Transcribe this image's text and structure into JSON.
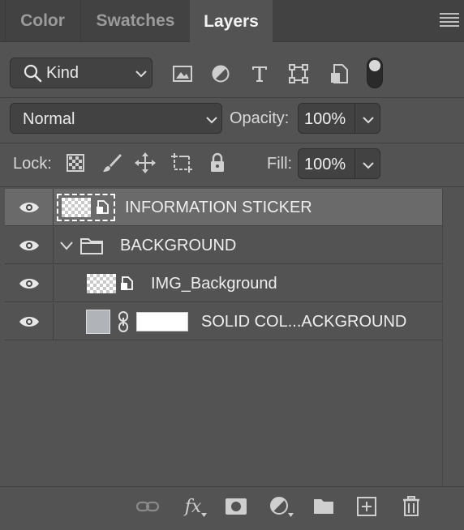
{
  "tabs": [
    {
      "label": "Color",
      "active": false
    },
    {
      "label": "Swatches",
      "active": false
    },
    {
      "label": "Layers",
      "active": true
    }
  ],
  "filter": {
    "kind_label": "Kind",
    "icons": [
      "image-filter-icon",
      "adjustment-filter-icon",
      "type-filter-icon",
      "shape-filter-icon",
      "smart-object-filter-icon"
    ],
    "toggle_on": true
  },
  "blend": {
    "mode": "Normal",
    "opacity_label": "Opacity:",
    "opacity_value": "100%"
  },
  "lock": {
    "label": "Lock:",
    "icons": [
      "lock-transparent-pixels-icon",
      "lock-image-pixels-icon",
      "lock-position-icon",
      "lock-artboard-icon",
      "lock-all-icon"
    ],
    "fill_label": "Fill:",
    "fill_value": "100%"
  },
  "layers": [
    {
      "name": "INFORMATION STICKER",
      "type": "smart-object",
      "selected": true,
      "visible": true,
      "indent": 0
    },
    {
      "name": "BACKGROUND",
      "type": "group",
      "selected": false,
      "visible": true,
      "expanded": true,
      "indent": 0
    },
    {
      "name": "IMG_Background",
      "type": "smart-object",
      "selected": false,
      "visible": true,
      "indent": 1
    },
    {
      "name": "SOLID COL...ACKGROUND",
      "type": "solid-color-fill",
      "selected": false,
      "visible": true,
      "indent": 1,
      "fill_color": "#b0b4b8",
      "mask_color": "#ffffff"
    }
  ],
  "bottom_icons": [
    "link-layers-icon",
    "layer-style-fx-icon",
    "add-mask-icon",
    "new-adjustment-layer-icon",
    "new-group-icon",
    "new-layer-icon",
    "delete-layer-icon"
  ],
  "colors": {
    "panel_bg": "#535353",
    "tabbar_bg": "#424242",
    "selected_row": "#6a6a6a"
  }
}
